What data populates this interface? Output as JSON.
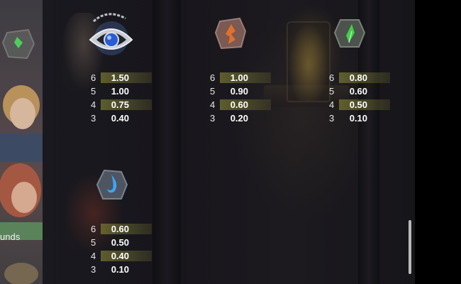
{
  "side_panel": {
    "truncated_label": "unds"
  },
  "symbols": [
    {
      "id": "eye-amulet",
      "icon": "eye-amulet-icon",
      "pays": [
        {
          "count": "6",
          "value": "1.50"
        },
        {
          "count": "5",
          "value": "1.00"
        },
        {
          "count": "4",
          "value": "0.75"
        },
        {
          "count": "3",
          "value": "0.40"
        }
      ]
    },
    {
      "id": "orange-rune",
      "icon": "orange-fire-rune-icon",
      "pays": [
        {
          "count": "6",
          "value": "1.00"
        },
        {
          "count": "5",
          "value": "0.90"
        },
        {
          "count": "4",
          "value": "0.60"
        },
        {
          "count": "3",
          "value": "0.20"
        }
      ]
    },
    {
      "id": "green-rune",
      "icon": "green-leaf-rune-icon",
      "pays": [
        {
          "count": "6",
          "value": "0.80"
        },
        {
          "count": "5",
          "value": "0.60"
        },
        {
          "count": "4",
          "value": "0.50"
        },
        {
          "count": "3",
          "value": "0.10"
        }
      ]
    },
    {
      "id": "blue-rune",
      "icon": "blue-water-rune-icon",
      "pays": [
        {
          "count": "6",
          "value": "0.60"
        },
        {
          "count": "5",
          "value": "0.50"
        },
        {
          "count": "4",
          "value": "0.40"
        },
        {
          "count": "3",
          "value": "0.10"
        }
      ]
    }
  ],
  "colors": {
    "highlight_row": "#96963c",
    "orange_rune": "#e0702a",
    "green_rune": "#3fcf4a",
    "blue_rune": "#3aa8ff",
    "amulet_gem": "#2a5bd6"
  }
}
